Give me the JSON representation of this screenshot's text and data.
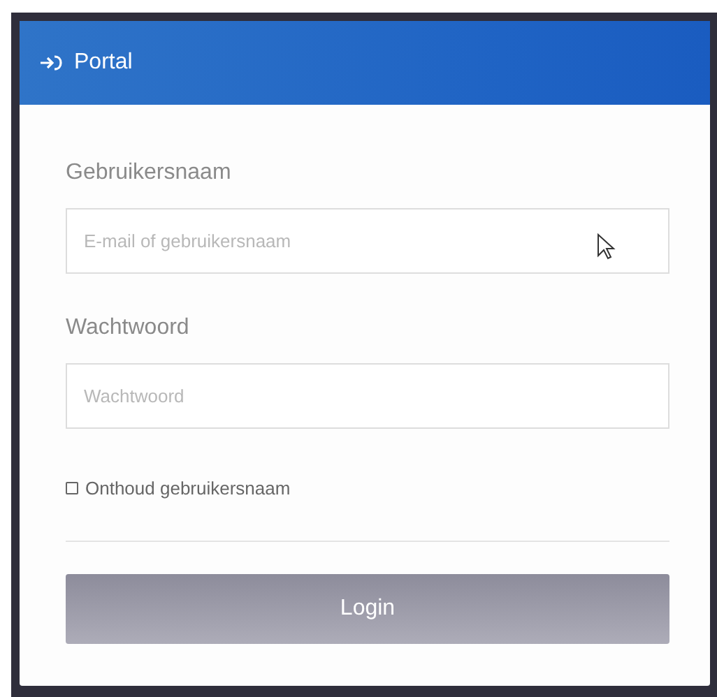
{
  "window": {
    "title": "Portal"
  },
  "fields": [
    {
      "label": "Gebruikersnaam",
      "placeholder": "E-mail of gebruikersnaam"
    },
    {
      "label": "Wachtwoord",
      "placeholder": "Wachtwoord"
    }
  ],
  "remember": {
    "label": "Onthoud gebruikersnaam",
    "checked": false
  },
  "login_button": {
    "label": "Login",
    "disabled": true
  }
}
